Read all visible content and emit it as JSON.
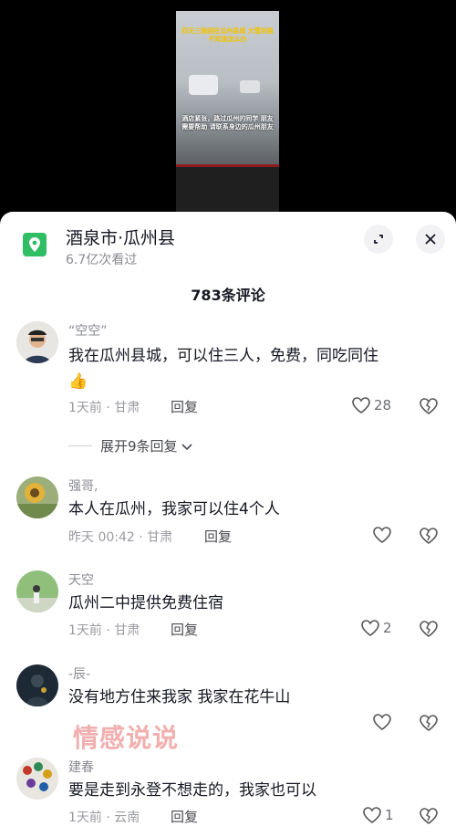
{
  "video": {
    "caption_top": "四天三晚困在瓜州县城 大雪封路不知道怎么办",
    "caption_mid": "酒店紧张，路过瓜州的同学 朋友需要帮助 请联系身边的瓜州朋友"
  },
  "location": {
    "title": "酒泉市·瓜州县",
    "views": "6.7亿次看过",
    "icon": "location-pin-icon"
  },
  "comments_header": "783条评论",
  "expand_replies": "展开9条回复",
  "watermark": "情感说说",
  "comments": [
    {
      "name": "“空空”",
      "text": "我在瓜州县城，可以住三人，免费，同吃同住",
      "emoji": "👍",
      "meta": "1天前 · 甘肃",
      "reply": "回复",
      "likes": "28"
    },
    {
      "name": "强哥,",
      "text": "本人在瓜州，我家可以住4个人",
      "meta": "昨天 00:42 · 甘肃",
      "reply": "回复",
      "likes": ""
    },
    {
      "name": "天空",
      "text": "瓜州二中提供免费住宿",
      "meta": "1天前 · 甘肃",
      "reply": "回复",
      "likes": "2"
    },
    {
      "name": "-辰-",
      "text": "没有地方住来我家 我家在花牛山",
      "meta": "1天前 · 甘肃",
      "reply": "回复",
      "likes": ""
    },
    {
      "name": "建春",
      "text": "要是走到永登不想走的，我家也可以",
      "meta": "1天前 · 云南",
      "reply": "回复",
      "likes": "1"
    }
  ]
}
